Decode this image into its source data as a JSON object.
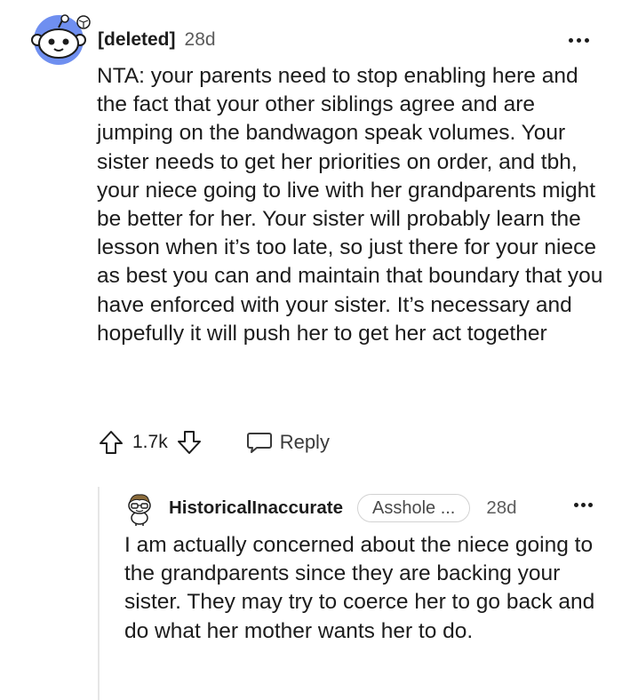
{
  "comment": {
    "username": "[deleted]",
    "age": "28d",
    "avatar_icon": "reddit-snoo-avatar-icon",
    "body": "NTA: your parents need to stop enabling here and the fact that your other siblings agree and are jumping on the bandwagon speak volumes. Your sister needs to get her priorities on order, and tbh, your niece going to live with her grandparents might be better for her. Your sister will probably learn the lesson when it’s too late, so just there for your niece as best you can and maintain that boundary that you have enforced with your sister. It’s necessary and hopefully it will push her to get her act together",
    "score": "1.7k",
    "reply_label": "Reply",
    "more_icon": "more-options-icon"
  },
  "reply": {
    "username": "HistoricalInaccurate",
    "flair": "Asshole ...",
    "age": "28d",
    "avatar_icon": "snoo-avatar-icon",
    "body": "I am actually concerned about the niece going to the grandparents since they are backing your sister. They may try to coerce her to go back and do what her mother wants her to do.",
    "more_icon": "more-options-icon"
  },
  "colors": {
    "avatar_bg": "#6f8ff0",
    "text": "#1c1c1c",
    "muted": "#5b5b5b",
    "thread_line": "#e6e6e6",
    "flair_border": "#d2d2d2"
  }
}
